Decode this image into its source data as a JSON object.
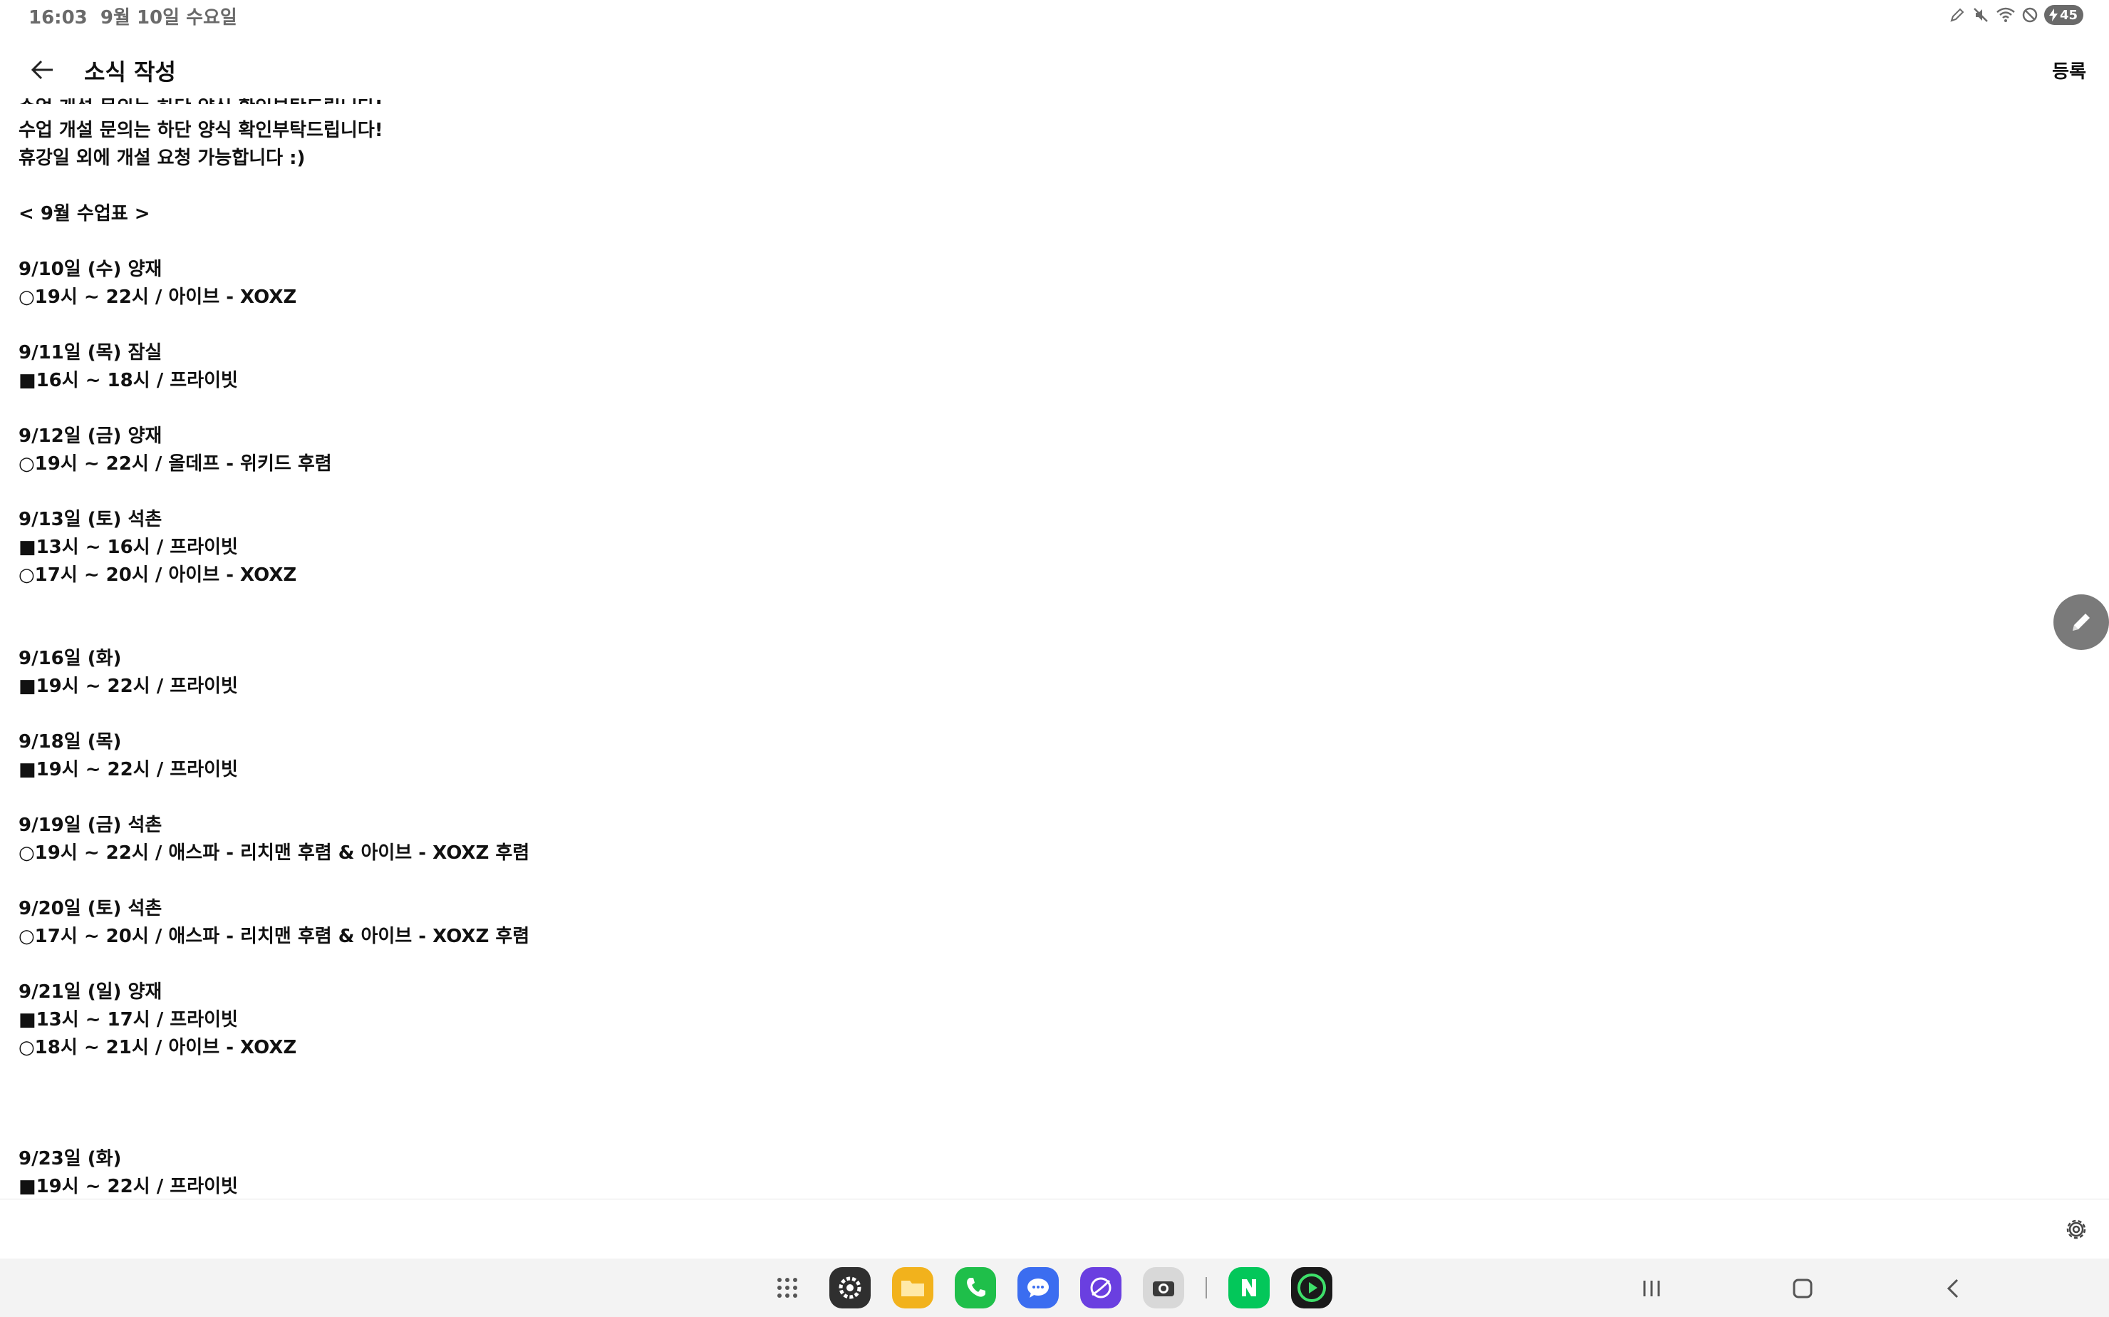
{
  "status_bar": {
    "time": "16:03",
    "date": "9월 10일 수요일",
    "battery": "45"
  },
  "header": {
    "title": "소식 작성",
    "register_label": "등록"
  },
  "editor": {
    "cut_off_line": "수업 개설 문의는 하단 양식 확인부탁드립니다!",
    "lines": [
      "수업 개설 문의는 하단 양식 확인부탁드립니다!",
      "휴강일 외에 개설 요청 가능합니다 :)",
      "",
      "< 9월 수업표 >",
      "",
      "9/10일 (수) 양재",
      "○19시 ~ 22시 / 아이브 - XOXZ",
      "",
      "9/11일 (목) 잠실",
      "■16시 ~ 18시 / 프라이빗",
      "",
      "9/12일 (금) 양재",
      "○19시 ~ 22시 / 올데프 - 위키드 후렴",
      "",
      "9/13일 (토) 석촌",
      "■13시 ~ 16시 / 프라이빗",
      "○17시 ~ 20시 / 아이브 - XOXZ",
      "",
      "",
      "9/16일 (화)",
      "■19시 ~ 22시 / 프라이빗",
      "",
      "9/18일 (목)",
      "■19시 ~ 22시 / 프라이빗",
      "",
      "9/19일 (금) 석촌",
      "○19시 ~ 22시 / 애스파 - 리치맨 후렴 & 아이브 - XOXZ 후렴",
      "",
      "9/20일 (토) 석촌",
      "○17시 ~ 20시 / 애스파 - 리치맨 후렴 & 아이브 - XOXZ 후렴",
      "",
      "9/21일 (일) 양재",
      "■13시 ~ 17시 / 프라이빗",
      "○18시 ~ 21시 / 아이브 - XOXZ",
      "",
      "",
      "",
      "9/23일 (화)",
      "■19시 ~ 22시 / 프라이빗"
    ]
  },
  "dock": {
    "apps": [
      {
        "name": "settings-app-icon",
        "color": "#3a3a3a"
      },
      {
        "name": "files-app-icon",
        "color": "#f2b21c"
      },
      {
        "name": "phone-app-icon",
        "color": "#1fbf4a"
      },
      {
        "name": "messages-app-icon",
        "color": "#3b6df0"
      },
      {
        "name": "internet-app-icon",
        "color": "#6a3fe0"
      },
      {
        "name": "camera-app-icon",
        "color": "#d8d8d8"
      },
      {
        "name": "naver-app-icon",
        "color": "#03c75a"
      },
      {
        "name": "player-app-icon",
        "color": "#1a1a1a"
      }
    ]
  },
  "colors": {
    "text": "#111111",
    "status_text": "#6a6a6a",
    "fab": "#7a7a7a",
    "taskbar": "#f3f3f3"
  }
}
